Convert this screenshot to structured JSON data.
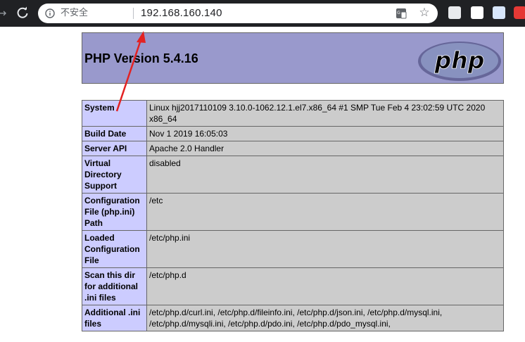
{
  "browser": {
    "security_label": "不安全",
    "url": "192.168.160.140"
  },
  "page": {
    "title": "PHP Version 5.4.16",
    "logo_text": "php",
    "rows": [
      {
        "label": "System",
        "value": "Linux hjj2017110109 3.10.0-1062.12.1.el7.x86_64 #1 SMP Tue Feb 4 23:02:59 UTC 2020 x86_64"
      },
      {
        "label": "Build Date",
        "value": "Nov 1 2019 16:05:03"
      },
      {
        "label": "Server API",
        "value": "Apache 2.0 Handler"
      },
      {
        "label": "Virtual Directory Support",
        "value": "disabled"
      },
      {
        "label": "Configuration File (php.ini) Path",
        "value": "/etc"
      },
      {
        "label": "Loaded Configuration File",
        "value": "/etc/php.ini"
      },
      {
        "label": "Scan this dir for additional .ini files",
        "value": "/etc/php.d"
      },
      {
        "label": "Additional .ini files",
        "value": "/etc/php.d/curl.ini, /etc/php.d/fileinfo.ini, /etc/php.d/json.ini, /etc/php.d/mysql.ini, /etc/php.d/mysqli.ini, /etc/php.d/pdo.ini, /etc/php.d/pdo_mysql.ini,"
      }
    ]
  },
  "colors": {
    "toolbar": "#202124",
    "header": "#9999cc",
    "label_cell": "#ccccff",
    "value_cell": "#cccccc",
    "arrow": "#e32222"
  }
}
